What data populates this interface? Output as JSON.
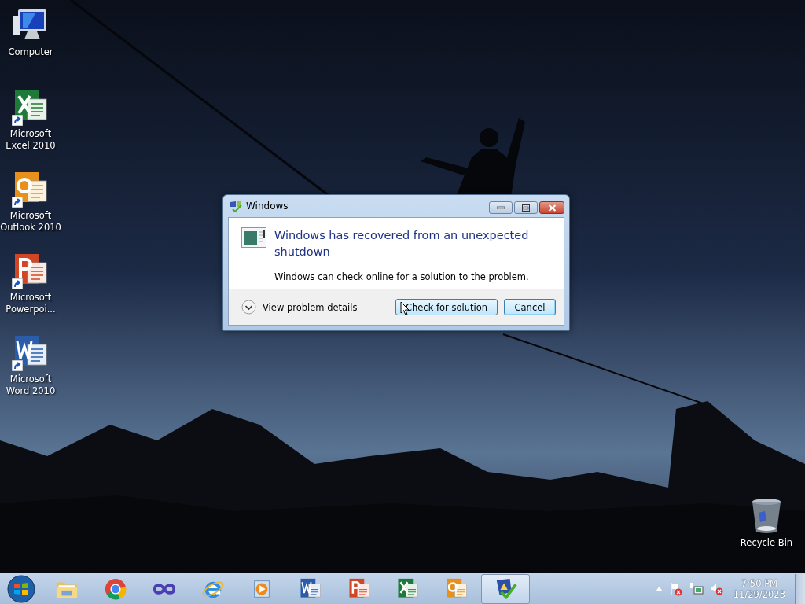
{
  "desktop_icons": [
    {
      "label": "Computer",
      "kind": "computer",
      "shortcut": false
    },
    {
      "label": "Microsoft Excel 2010",
      "kind": "excel",
      "shortcut": true
    },
    {
      "label": "Microsoft Outlook 2010",
      "kind": "outlook",
      "shortcut": true
    },
    {
      "label": "Microsoft Powerpoi...",
      "kind": "powerpoint",
      "shortcut": true
    },
    {
      "label": "Microsoft Word 2010",
      "kind": "word",
      "shortcut": true
    }
  ],
  "recycle_bin": {
    "label": "Recycle Bin"
  },
  "dialog": {
    "title": "Windows",
    "heading": "Windows has recovered from an unexpected shutdown",
    "message": "Windows can check online for a solution to the problem.",
    "details_toggle": "View problem details",
    "buttons": [
      {
        "label": "Check for solution",
        "focused": false
      },
      {
        "label": "Cancel",
        "focused": true
      }
    ]
  },
  "taskbar": {
    "apps": [
      {
        "kind": "explorer",
        "active": false
      },
      {
        "kind": "chrome",
        "active": false
      },
      {
        "kind": "infinity",
        "active": false
      },
      {
        "kind": "ie",
        "active": false
      },
      {
        "kind": "media",
        "active": false
      },
      {
        "kind": "word",
        "active": false
      },
      {
        "kind": "powerpoint",
        "active": false
      },
      {
        "kind": "excel",
        "active": false
      },
      {
        "kind": "outlook",
        "active": false
      },
      {
        "kind": "action-center",
        "active": true
      }
    ],
    "clock": {
      "time": "7:50 PM",
      "date": "11/29/2023"
    }
  }
}
